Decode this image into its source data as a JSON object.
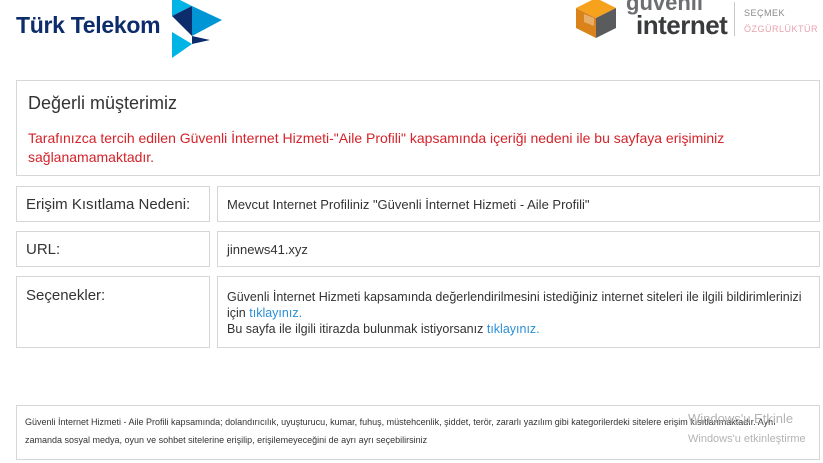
{
  "header": {
    "brand_left": "Türk Telekom",
    "brand_right_top": "güvenli",
    "brand_right_bottom": "internet",
    "slogan_top": "SEÇMEK",
    "slogan_bottom": "ÖZGÜRLÜKTÜR"
  },
  "notice": {
    "greeting": "Değerli müşterimiz",
    "message": "Tarafınızca tercih edilen Güvenli İnternet Hizmeti-\"Aile Profili\" kapsamında içeriği nedeni ile bu sayfaya erişiminiz sağlanamamaktadır."
  },
  "details": {
    "reason_label": "Erişim Kısıtlama Nedeni:",
    "reason_value": "Mevcut Internet Profiliniz \"Güvenli İnternet Hizmeti - Aile Profili\"",
    "url_label": "URL:",
    "url_value": "jinnews41.xyz",
    "options_label": "Seçenekler:",
    "options_text1": "Güvenli İnternet Hizmeti kapsamında değerlendirilmesini istediğiniz internet siteleri ile ilgili bildirimlerinizi için",
    "options_link1": "tıklayınız.",
    "options_text2": "Bu sayfa ile ilgili itirazda bulunmak istiyorsanız",
    "options_link2": "tıklayınız."
  },
  "footer": {
    "text": "Güvenli İnternet Hizmeti - Aile Profili kapsamında; dolandırıcılık, uyuşturucu, kumar, fuhuş, müstehcenlik, şiddet, terör, zararlı yazılım gibi kategorilerdeki sitelere erişim kısıtlanmaktadır. Aynı zamanda sosyal medya, oyun ve sohbet sitelerine erişilip, erişilemeyeceğini de ayrı ayrı seçebilirsiniz"
  },
  "watermark": {
    "line1": "Windows'u Etkinle",
    "line2": "Windows'u etkinleştirme"
  },
  "colors": {
    "warning": "#d4232a",
    "link": "#2b8fd6",
    "brand_navy": "#0d2c6c",
    "brand_cyan": "#00b4e6"
  }
}
